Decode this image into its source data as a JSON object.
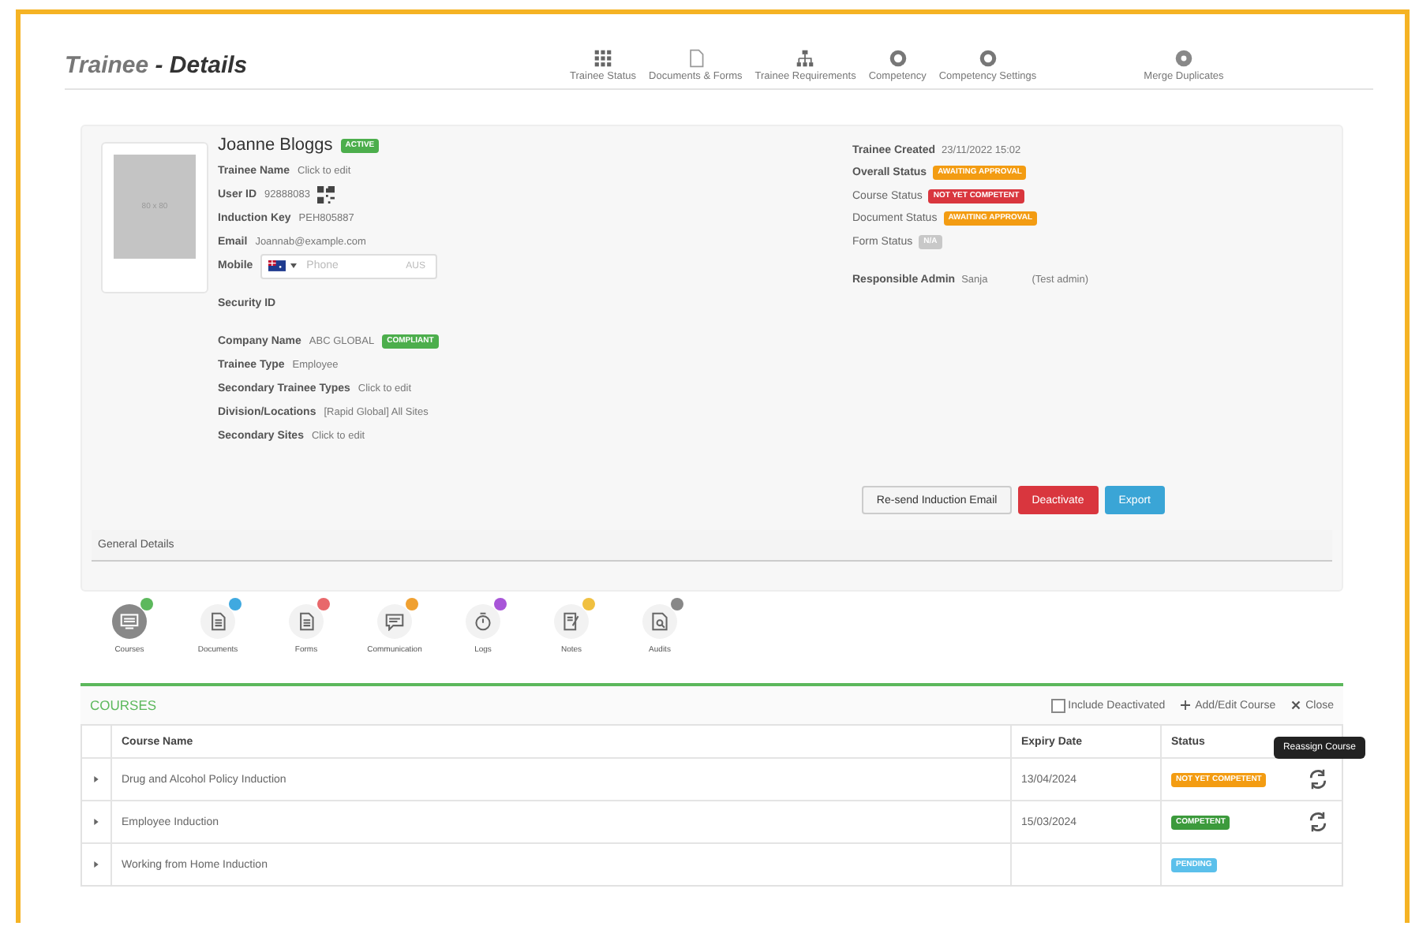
{
  "header": {
    "title_part": "Trainee",
    "title_rest": "- Details",
    "nav": [
      {
        "label": "Trainee Status",
        "kind": "grid"
      },
      {
        "label": "Documents & Forms",
        "kind": "doc"
      },
      {
        "label": "Trainee Requirements",
        "kind": "tree"
      },
      {
        "label": "Competency",
        "kind": "circle"
      },
      {
        "label": "Competency Settings",
        "kind": "circle"
      },
      {
        "label": "Merge Duplicates",
        "kind": "merge"
      }
    ]
  },
  "profile": {
    "photo_text": "80 x 80",
    "name": "Joanne Bloggs",
    "name_badge": "ACTIVE",
    "fields": [
      {
        "label": "Trainee Name",
        "value": "Click to edit",
        "kind": "text"
      },
      {
        "label": "User ID",
        "value": "92888083",
        "kind": "qr"
      },
      {
        "label": "Induction Key",
        "value": "PEH805887",
        "kind": "text"
      },
      {
        "label": "Email",
        "value": "Joannab@example.com",
        "kind": "text"
      },
      {
        "label": "Mobile",
        "placeholder": "Phone",
        "suffix": "AUS",
        "kind": "phone"
      },
      {
        "label": "Security ID",
        "kind": "gap"
      },
      {
        "label": "Company Name",
        "value": "ABC GLOBAL",
        "badge": "COMPLIANT",
        "kind": "badge"
      },
      {
        "label": "Trainee Type",
        "value": "Employee",
        "kind": "text"
      },
      {
        "label": "Secondary Trainee Types",
        "value": "Click to edit",
        "kind": "text"
      },
      {
        "label": "Division/Locations",
        "value": "[Rapid Global] All Sites",
        "kind": "text"
      },
      {
        "label": "Secondary Sites",
        "value": "Click to edit",
        "kind": "text"
      }
    ],
    "created_label": "Trainee Created",
    "created_value": "23/11/2022 15:02",
    "statuses": [
      {
        "label": "Overall Status",
        "badge": "AWAITING APPROVAL",
        "color": "#f39c12",
        "bold": true
      },
      {
        "label": "Course Status",
        "badge": "NOT YET COMPETENT",
        "color": "#d9363e",
        "bold": false
      },
      {
        "label": "Document Status",
        "badge": "AWAITING APPROVAL",
        "color": "#f39c12",
        "bold": false
      },
      {
        "label": "Form Status",
        "badge": "N/A",
        "color": "#c8c8c8",
        "bold": false
      }
    ],
    "admin_label": "Responsible Admin",
    "admin_value": "Sanja",
    "admin_note": "(Test admin)",
    "buttons": [
      {
        "label": "Re-send Induction Email",
        "kind": "default"
      },
      {
        "label": "Deactivate",
        "kind": "danger"
      },
      {
        "label": "Export",
        "kind": "info"
      }
    ],
    "section": "General Details"
  },
  "tabs": [
    {
      "label": "Courses",
      "selected": true,
      "color": "#5cb85c",
      "kind": "screen"
    },
    {
      "label": "Documents",
      "selected": false,
      "color": "#3fa9e0",
      "kind": "doc"
    },
    {
      "label": "Forms",
      "selected": false,
      "color": "#e8686b",
      "kind": "doc"
    },
    {
      "label": "Communication",
      "selected": false,
      "color": "#f0a030",
      "kind": "chat"
    },
    {
      "label": "Logs",
      "selected": false,
      "color": "#a855d8",
      "kind": "timer"
    },
    {
      "label": "Notes",
      "selected": false,
      "color": "#f0c040",
      "kind": "note"
    },
    {
      "label": "Audits",
      "selected": false,
      "color": "#888888",
      "kind": "audit"
    }
  ],
  "courses": {
    "title": "COURSES",
    "include_label": "Include Deactivated",
    "include_checked": false,
    "add_label": "Add/Edit Course",
    "close_label": "Close",
    "columns": [
      "Course Name",
      "Expiry Date",
      "Status"
    ],
    "rows": [
      {
        "name": "Drug and Alcohol Policy Induction",
        "expiry": "13/04/2024",
        "status": "NOT YET COMPETENT",
        "color": "#f39c12",
        "reassign": true
      },
      {
        "name": "Employee Induction",
        "expiry": "15/03/2024",
        "status": "COMPETENT",
        "color": "#3c9a3c",
        "reassign": true
      },
      {
        "name": "Working from Home Induction",
        "status": "PENDING",
        "color": "#5bc0eb",
        "reassign": false
      }
    ],
    "tooltip": "Reassign Course"
  }
}
